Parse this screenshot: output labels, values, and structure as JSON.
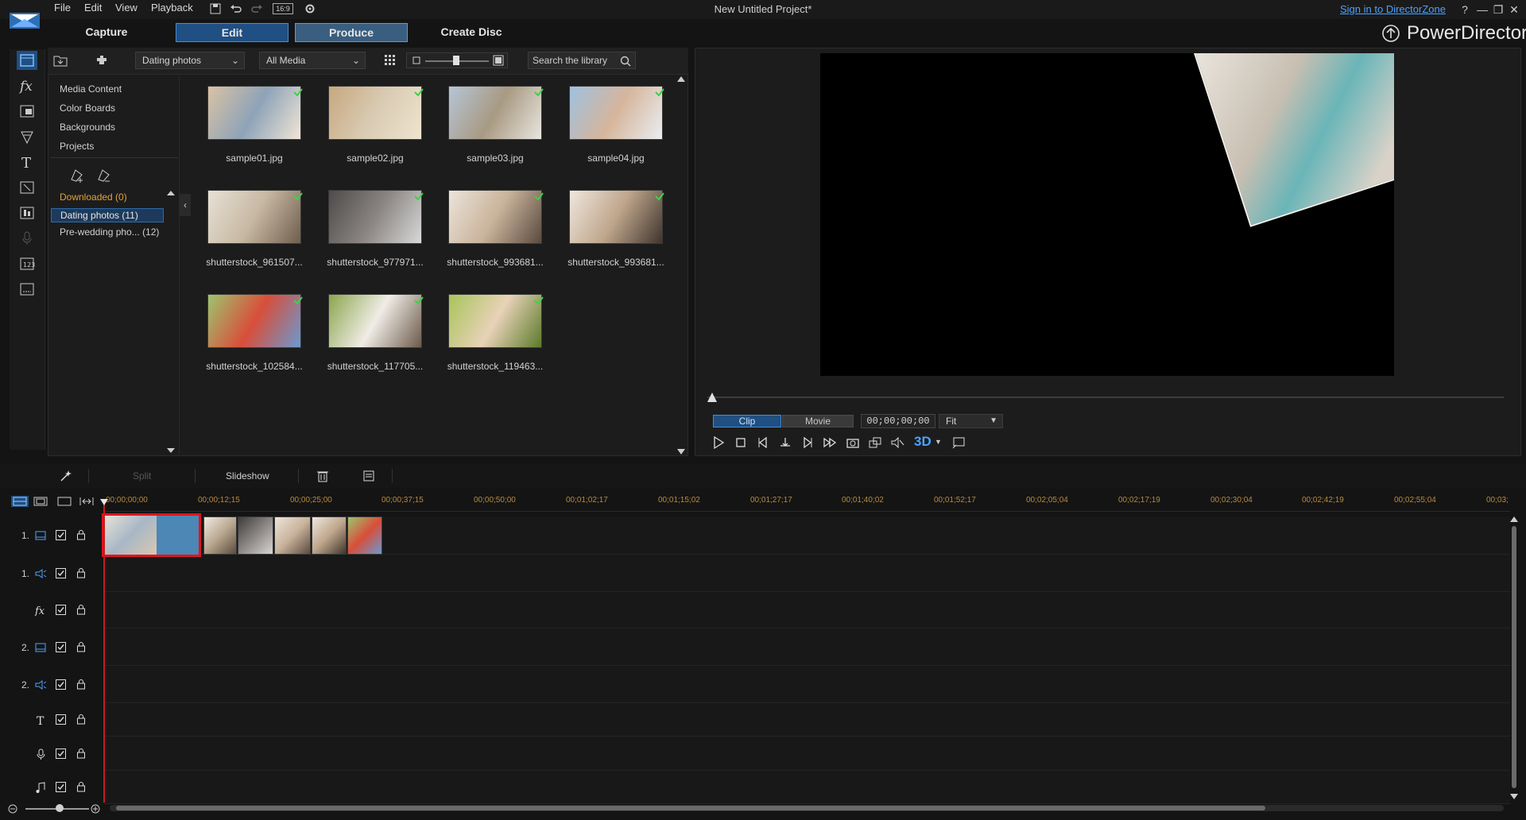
{
  "menu": {
    "file": "File",
    "edit": "Edit",
    "view": "View",
    "playback": "Playback",
    "aspect": "16:9"
  },
  "window": {
    "title": "New Untitled Project*",
    "signin": "Sign in to DirectorZone",
    "help": "?",
    "minimize": "—",
    "restore": "❐",
    "close": "✕"
  },
  "modes": {
    "capture": "Capture",
    "edit": "Edit",
    "produce": "Produce",
    "create_disc": "Create Disc"
  },
  "brand": "PowerDirector",
  "library": {
    "tag_dropdown": "Dating photos",
    "media_dropdown": "All Media",
    "search_placeholder": "Search the library",
    "tree": [
      "Media Content",
      "Color Boards",
      "Backgrounds",
      "Projects"
    ],
    "tags": [
      {
        "label": "Downloaded  (0)"
      },
      {
        "label": "Dating photos  (11)"
      },
      {
        "label": "Pre-wedding pho...  (12)"
      }
    ],
    "items": [
      {
        "label": "sample01.jpg",
        "colors": [
          "#d9c2a4",
          "#8ea3b8",
          "#f1e6d6"
        ]
      },
      {
        "label": "sample02.jpg",
        "colors": [
          "#c7a77e",
          "#d9cbb3",
          "#efe4cf"
        ]
      },
      {
        "label": "sample03.jpg",
        "colors": [
          "#b6c5d6",
          "#a89a83",
          "#e9e6df"
        ]
      },
      {
        "label": "sample04.jpg",
        "colors": [
          "#9fc1e0",
          "#d6b59b",
          "#e9eef2"
        ]
      },
      {
        "label": "shutterstock_961507...",
        "colors": [
          "#e8e1d6",
          "#c7b8a2",
          "#6f5e4e"
        ]
      },
      {
        "label": "shutterstock_977971...",
        "colors": [
          "#4d4b4a",
          "#8a8582",
          "#d9d9d9"
        ]
      },
      {
        "label": "shutterstock_993681...",
        "colors": [
          "#ece4da",
          "#c9b39b",
          "#5a4a3f"
        ]
      },
      {
        "label": "shutterstock_993681...",
        "colors": [
          "#efe7de",
          "#bfa68c",
          "#3f342d"
        ]
      },
      {
        "label": "shutterstock_102584...",
        "colors": [
          "#9ec46e",
          "#d84e3a",
          "#6a9ad2"
        ]
      },
      {
        "label": "shutterstock_117705...",
        "colors": [
          "#8aa64c",
          "#f0ece6",
          "#6b5a4a"
        ]
      },
      {
        "label": "shutterstock_119463...",
        "colors": [
          "#a8c45a",
          "#e8d2b8",
          "#5b7a2a"
        ]
      }
    ]
  },
  "preview": {
    "clip": "Clip",
    "movie": "Movie",
    "timecode": "00;00;00;00",
    "fit": "Fit",
    "three_d": "3D"
  },
  "edit_toolbar": {
    "split": "Split",
    "slideshow": "Slideshow"
  },
  "timeline": {
    "ruler": [
      "00;00;00;00",
      "00;00;12;15",
      "00;00;25;00",
      "00;00;37;15",
      "00;00;50;00",
      "00;01;02;17",
      "00;01;15;02",
      "00;01;27;17",
      "00;01;40;02",
      "00;01;52;17",
      "00;02;05;04",
      "00;02;17;19",
      "00;02;30;04",
      "00;02;42;19",
      "00;02;55;04",
      "00;03;"
    ],
    "tracks": [
      {
        "num": "1.",
        "icon": "video-track-icon"
      },
      {
        "num": "1.",
        "icon": "audio-track-icon"
      },
      {
        "num": "",
        "icon": "fx-track-icon"
      },
      {
        "num": "2.",
        "icon": "video-track-icon"
      },
      {
        "num": "2.",
        "icon": "audio-track-icon"
      },
      {
        "num": "",
        "icon": "title-track-icon"
      },
      {
        "num": "",
        "icon": "voice-track-icon"
      },
      {
        "num": "",
        "icon": "music-track-icon"
      }
    ]
  },
  "colors": {
    "accent": "#1f4f83",
    "selection": "#e0151d",
    "ruler_text": "#b88a3a",
    "tag_downloaded": "#e3a23a"
  }
}
